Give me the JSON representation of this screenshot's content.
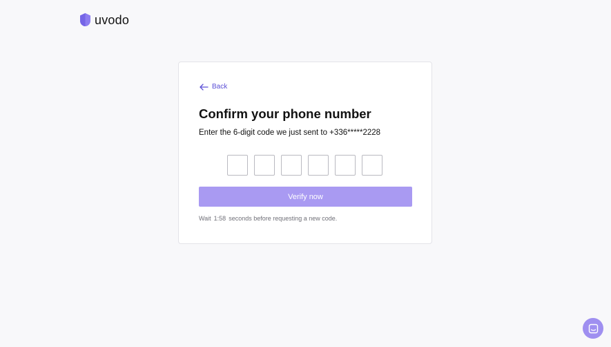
{
  "brand": {
    "name": "uvodo",
    "logo_icon": "shield-logo-icon",
    "accent_color": "#5b4fd6",
    "logo_color": "#8c7cf0"
  },
  "card": {
    "back_label": "Back",
    "back_icon": "arrow-left-icon",
    "title": "Confirm your phone number",
    "subtitle": "Enter the 6-digit code we just sent to +336*****2228",
    "code_digits": [
      "",
      "",
      "",
      "",
      "",
      ""
    ],
    "verify_label": "Verify now",
    "verify_color": "#a99af2",
    "wait": {
      "prefix": "Wait",
      "timer": "1:58",
      "suffix": "seconds before requesting a new code."
    }
  },
  "chat": {
    "icon": "chat-icon",
    "color": "#9f8ff0"
  }
}
